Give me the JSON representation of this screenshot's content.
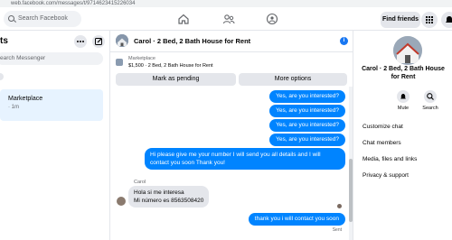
{
  "browser": {
    "url": "web.facebook.com/messages/t/9714623415226034"
  },
  "topnav": {
    "search_placeholder": "Search Facebook",
    "find_friends_label": "Find friends"
  },
  "sidebar": {
    "title": "ts",
    "search_placeholder": "earch Messenger",
    "conversations": [
      {
        "title": "Marketplace",
        "time": "· 1m"
      }
    ]
  },
  "chat": {
    "title": "Carol · 2 Bed, 2 Bath House for Rent",
    "marketplace_label": "Marketplace",
    "listing": "$1,500 · 2 Bed, 2 Bath House for Rent",
    "mark_pending_label": "Mark as pending",
    "more_options_label": "More options",
    "messages": [
      {
        "dir": "out",
        "text": "Yes, are you interested?"
      },
      {
        "dir": "out",
        "text": "Yes, are you interested?"
      },
      {
        "dir": "out",
        "text": "Yes, are you interested?"
      },
      {
        "dir": "out",
        "text": "Yes, are you interested?"
      },
      {
        "dir": "out",
        "text": "Hi please give me your number I will send you all details and I will contact you soon Thank you!"
      },
      {
        "dir": "in",
        "sender": "Carol",
        "text": "Hola si me interesa\nMi número es 8563508420"
      },
      {
        "dir": "out",
        "text": "thank you i will contact you soon"
      }
    ],
    "sent_label": "Sent"
  },
  "details": {
    "name": "Carol · 2 Bed, 2 Bath House for Rent",
    "mute_label": "Mute",
    "search_label": "Search",
    "menu": [
      "Customize chat",
      "Chat members",
      "Media, files and links",
      "Privacy & support"
    ]
  },
  "colors": {
    "brand": "#1877f2",
    "bubble_out": "#0084ff",
    "bubble_in": "#e4e6eb"
  }
}
